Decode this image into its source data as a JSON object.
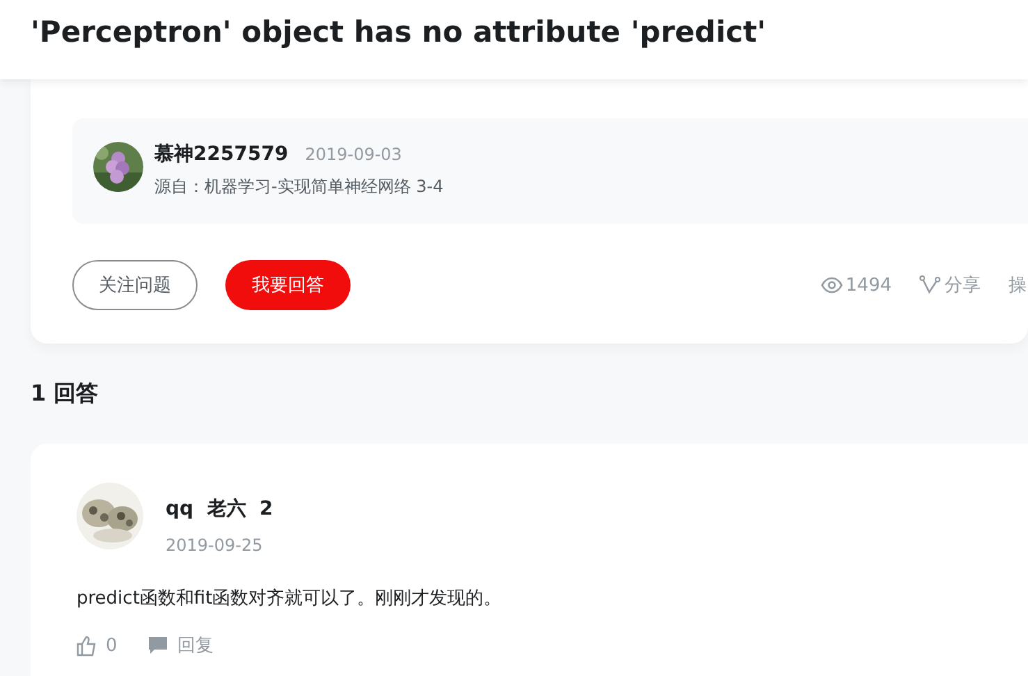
{
  "header": {
    "title": "'Perceptron' object has no attribute 'predict'"
  },
  "question": {
    "author": {
      "name": "慕神2257579",
      "date": "2019-09-03",
      "source": "源自：机器学习-实现简单神经网络  3-4"
    },
    "buttons": [
      {
        "label": "关注问题",
        "kind": "outline"
      },
      {
        "label": "我要回答",
        "kind": "primary"
      }
    ],
    "stats": [
      {
        "kind": "views",
        "label": "1494"
      },
      {
        "kind": "share",
        "label": "分享"
      },
      {
        "kind": "text",
        "label": "操"
      }
    ]
  },
  "answers_heading": "1 回答",
  "answers": [
    {
      "name": "qq  老六  2",
      "date": "2019-09-25",
      "content": "predict函数和fit函数对齐就可以了。刚刚才发现的。",
      "likes": "0",
      "reply": "回复"
    }
  ]
}
